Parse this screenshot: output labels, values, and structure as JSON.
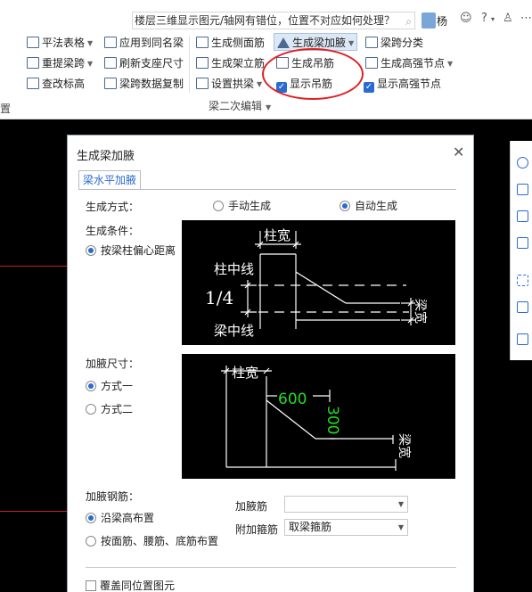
{
  "topbar": {
    "search_text": "楼层三维显示图元/轴网有错位，位置不对应如何处理？",
    "user": "杨"
  },
  "ribbon": {
    "buttons": [
      {
        "label": "平法表格"
      },
      {
        "label": "应用到同名梁"
      },
      {
        "label": "生成侧面筋"
      },
      {
        "label": "生成梁加腋"
      },
      {
        "label": "梁跨分类"
      },
      {
        "label": "重提梁跨"
      },
      {
        "label": "刷新支座尺寸"
      },
      {
        "label": "生成架立筋"
      },
      {
        "label": "生成吊筋"
      },
      {
        "label": "生成高强节点"
      },
      {
        "label": "查改标高"
      },
      {
        "label": "梁跨数据复制"
      },
      {
        "label": "设置拱梁"
      },
      {
        "label": "显示吊筋"
      },
      {
        "label": "显示高强节点"
      }
    ],
    "group_label": "梁二次编辑",
    "left_fragment": "置"
  },
  "dialog": {
    "title": "生成梁加腋",
    "tab": "梁水平加腋",
    "gen_method_label": "生成方式：",
    "manual": "手动生成",
    "auto": "自动生成",
    "gen_method_selected": "auto",
    "gen_cond_label": "生成条件：",
    "cond_option": "按梁柱偏心距离",
    "diagram1": {
      "col_width": "柱宽",
      "col_center": "柱中线",
      "fraction": "1/4",
      "beam_center": "梁中线",
      "beam_width": "梁宽"
    },
    "size_label": "加腋尺寸：",
    "size_opt1": "方式一",
    "size_opt2": "方式二",
    "size_selected": "1",
    "diagram2": {
      "col_width": "柱宽",
      "len": "600",
      "depth": "300",
      "beam_width": "梁宽"
    },
    "rebar_label": "加腋钢筋：",
    "rebar_opt1": "沿梁高布置",
    "rebar_opt2": "按面筋、腰筋、底筋布置",
    "rebar_selected": "1",
    "haunch_bar_label": "加腋筋",
    "haunch_bar_value": "",
    "stirrup_label": "附加箍筋",
    "stirrup_value": "取梁箍筋",
    "cover_label": "覆盖同位置图元"
  }
}
